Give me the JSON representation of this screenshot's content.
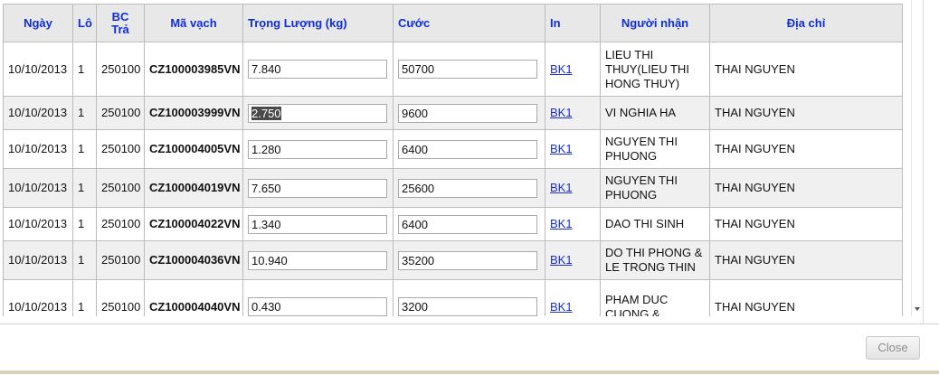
{
  "columns": {
    "date": "Ngày",
    "lot": "Lô",
    "bc_line1": "BC",
    "bc_line2": "Trả",
    "barcode": "Mã vạch",
    "weight": "Trọng Lượng (kg)",
    "fee": "Cước",
    "print": "In",
    "recipient": "Người nhận",
    "address": "Địa chỉ"
  },
  "rows": [
    {
      "date": "10/10/2013",
      "lot": "1",
      "bc": "250100",
      "code": "CZ100003985VN",
      "weight": "7.840",
      "fee": "50700",
      "print": "BK1",
      "recipient": "LIEU THI THUY(LIEU THI HONG THUY)",
      "address": "THAI NGUYEN"
    },
    {
      "date": "10/10/2013",
      "lot": "1",
      "bc": "250100",
      "code": "CZ100003999VN",
      "weight": "2.750",
      "fee": "9600",
      "print": "BK1",
      "recipient": "VI NGHIA HA",
      "address": "THAI NGUYEN"
    },
    {
      "date": "10/10/2013",
      "lot": "1",
      "bc": "250100",
      "code": "CZ100004005VN",
      "weight": "1.280",
      "fee": "6400",
      "print": "BK1",
      "recipient": "NGUYEN THI PHUONG",
      "address": "THAI NGUYEN"
    },
    {
      "date": "10/10/2013",
      "lot": "1",
      "bc": "250100",
      "code": "CZ100004019VN",
      "weight": "7.650",
      "fee": "25600",
      "print": "BK1",
      "recipient": "NGUYEN THI PHUONG",
      "address": "THAI NGUYEN"
    },
    {
      "date": "10/10/2013",
      "lot": "1",
      "bc": "250100",
      "code": "CZ100004022VN",
      "weight": "1.340",
      "fee": "6400",
      "print": "BK1",
      "recipient": "DAO THI SINH",
      "address": "THAI NGUYEN"
    },
    {
      "date": "10/10/2013",
      "lot": "1",
      "bc": "250100",
      "code": "CZ100004036VN",
      "weight": "10.940",
      "fee": "35200",
      "print": "BK1",
      "recipient": "DO THI PHONG & LE TRONG THIN",
      "address": "THAI NGUYEN"
    },
    {
      "date": "10/10/2013",
      "lot": "1",
      "bc": "250100",
      "code": "CZ100004040VN",
      "weight": "0.430",
      "fee": "3200",
      "print": "BK1",
      "recipient": "PHAM DUC CUONG &",
      "address": "THAI NGUYEN"
    }
  ],
  "selected_row": 1,
  "footer": {
    "close_label": "Close"
  },
  "icons": {
    "scroll_down": "scroll-down-arrow-icon"
  }
}
